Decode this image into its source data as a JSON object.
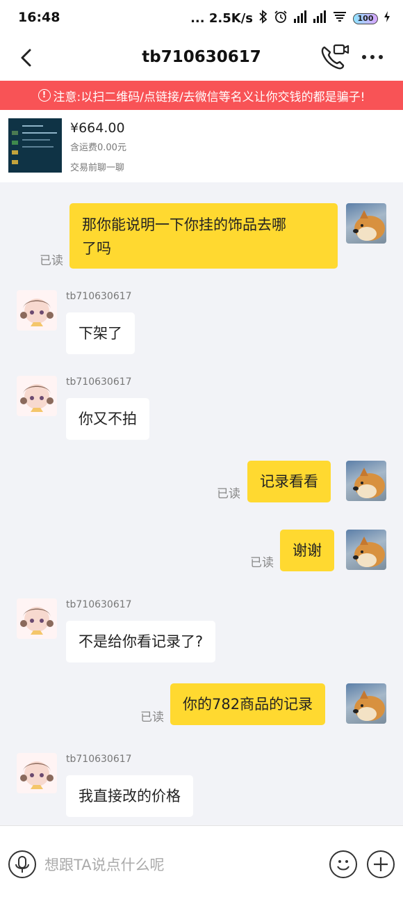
{
  "status_bar": {
    "time": "16:48",
    "network_speed": "... 2.5K/s",
    "battery": "100"
  },
  "header": {
    "title": "tb710630617"
  },
  "warning": {
    "text": "注意:以扫二维码/点链接/去微信等名义让你交钱的都是骗子!"
  },
  "product": {
    "price": "¥664.00",
    "shipping": "含运费0.00元",
    "note": "交易前聊一聊"
  },
  "messages": [
    {
      "from": "me",
      "text_line1": "那你能说明一下你挂的饰品去哪",
      "text_line2": "了吗",
      "status": "已读"
    },
    {
      "from": "them",
      "sender": "tb710630617",
      "text": "下架了"
    },
    {
      "from": "them",
      "sender": "tb710630617",
      "text": "你又不拍"
    },
    {
      "from": "me",
      "text": "记录看看",
      "status": "已读"
    },
    {
      "from": "me",
      "text": "谢谢",
      "status": "已读"
    },
    {
      "from": "them",
      "sender": "tb710630617",
      "text": "不是给你看记录了?"
    },
    {
      "from": "me",
      "text": "你的782商品的记录",
      "status": "已读"
    },
    {
      "from": "them",
      "sender": "tb710630617",
      "text": "我直接改的价格"
    }
  ],
  "input": {
    "placeholder": "想跟TA说点什么呢"
  },
  "icons": {
    "back": "chevron-left-icon",
    "call": "phone-video-icon",
    "more": "more-dots-icon",
    "mic": "microphone-icon",
    "emoji": "smile-icon",
    "plus": "plus-icon"
  },
  "colors": {
    "warning_bg": "#f85356",
    "my_bubble": "#ffd930",
    "their_bubble": "#ffffff",
    "chat_bg": "#f2f3f7"
  }
}
